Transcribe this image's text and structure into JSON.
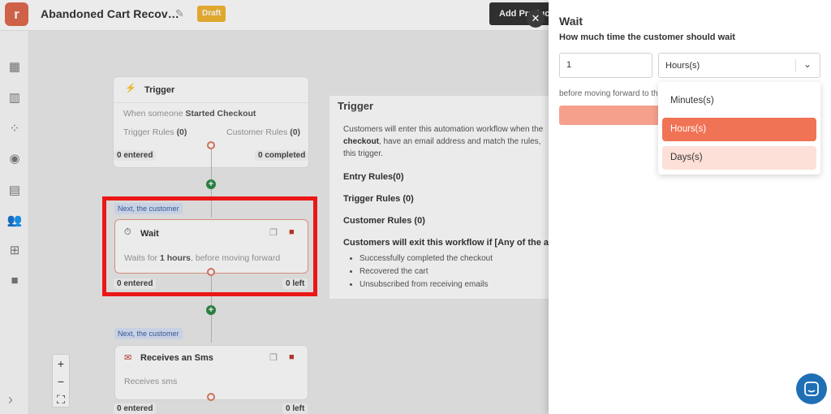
{
  "header": {
    "logo_letter": "r",
    "title": "Abandoned Cart Recov…",
    "status_badge": "Draft",
    "add_product_label": "Add Product F"
  },
  "canvas": {
    "trigger_node": {
      "title": "Trigger",
      "subtitle_prefix": "When someone",
      "subtitle_event": "Started Checkout",
      "trigger_rules_label": "Trigger Rules",
      "trigger_rules_count": "(0)",
      "customer_rules_label": "Customer Rules",
      "customer_rules_count": "(0)",
      "entered": "0 entered",
      "completed": "0 completed"
    },
    "wait_node": {
      "next_badge": "Next, the customer",
      "title": "Wait",
      "desc_prefix": "Waits for",
      "desc_value": "1 hours",
      "desc_suffix": ", before moving forward",
      "entered": "0 entered",
      "left": "0 left"
    },
    "sms_node": {
      "next_badge": "Next, the customer",
      "title": "Receives an Sms",
      "desc": "Receives sms",
      "entered": "0 entered",
      "left": "0 left"
    },
    "trigger_panel": {
      "title": "Trigger",
      "desc_part1": "Customers will enter this automation workflow when the",
      "desc_bold": "checkout",
      "desc_part2": ", have an email address and match the rules,",
      "desc_part3": "this trigger.",
      "entry_rules": "Entry Rules(0)",
      "trigger_rules": "Trigger Rules  (0)",
      "customer_rules": "Customer Rules  (0)",
      "exit_heading": "Customers will exit this workflow if [Any of the a",
      "exit_items": [
        "Successfully completed the checkout",
        "Recovered the cart",
        "Unsubscribed from receiving emails"
      ]
    },
    "zoom": {
      "in": "+",
      "out": "−",
      "fit": "⛶"
    }
  },
  "wait_panel": {
    "title": "Wait",
    "question": "How much time the customer should wait",
    "amount_value": "1",
    "unit_selected": "Hours(s)",
    "before_text": "before moving forward to th",
    "options": [
      "Minutes(s)",
      "Hours(s)",
      "Days(s)"
    ]
  },
  "colors": {
    "accent": "#f07355",
    "highlight": "#ff1a1a",
    "draft": "#f2b632",
    "chat": "#1f6fb5"
  }
}
